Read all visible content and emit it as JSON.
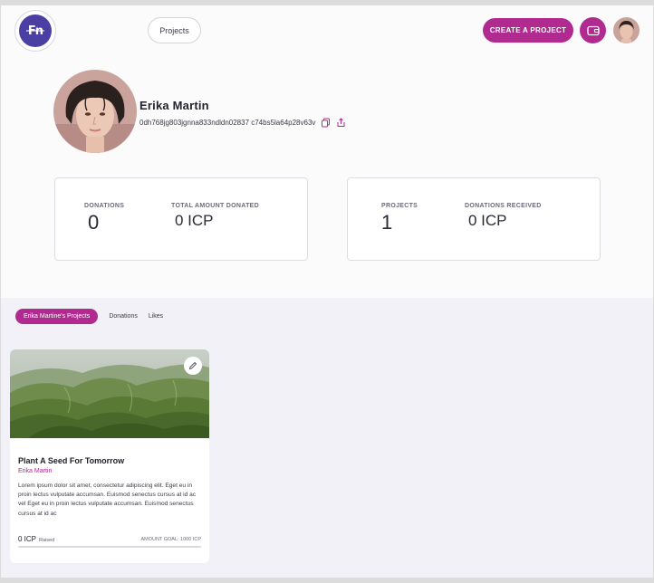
{
  "header": {
    "logo_text": "Fn",
    "nav_projects": "Projects",
    "create_button": "CREATE A PROJECT",
    "wallet_icon": "wallet-icon"
  },
  "profile": {
    "name": "Erika Martin",
    "wallet_address": "0dh768jg803jgnna833ndldn02837 c74bs5la64p28v63v",
    "copy_icon": "copy-icon",
    "share_icon": "share-icon"
  },
  "stats_left": {
    "donations_label": "DONATIONS",
    "donations_value": "0",
    "total_label": "TOTAL AMOUNT DONATED",
    "total_value": "0 ICP"
  },
  "stats_right": {
    "projects_label": "PROJECTS",
    "projects_value": "1",
    "received_label": "DONATIONS RECEIVED",
    "received_value": "0 ICP"
  },
  "tabs": [
    {
      "label": "Erika Martine's Projects",
      "active": true
    },
    {
      "label": "Donations",
      "active": false
    },
    {
      "label": "Likes",
      "active": false
    }
  ],
  "project_card": {
    "title": "Plant A Seed For Tomorrow",
    "author": "Erika Martin",
    "description": "Lorem ipsum dolor sit amet, consectetur adipiscing elit. Eget eu in proin lectus vulputate accumsan. Euismod senectus cursus at id ac vel Eget eu in proin lectus vulputate accumsan. Euismod senectus cursus at id ac",
    "raised_value": "0 ICP",
    "raised_label": "Raised",
    "goal": "AMOUNT GOAL: 1000 ICP",
    "progress": 0,
    "edit_icon": "pencil-icon"
  },
  "colors": {
    "accent": "#b02a8f",
    "logo": "#4b3fa3",
    "lower_bg": "#f1f1f7"
  }
}
